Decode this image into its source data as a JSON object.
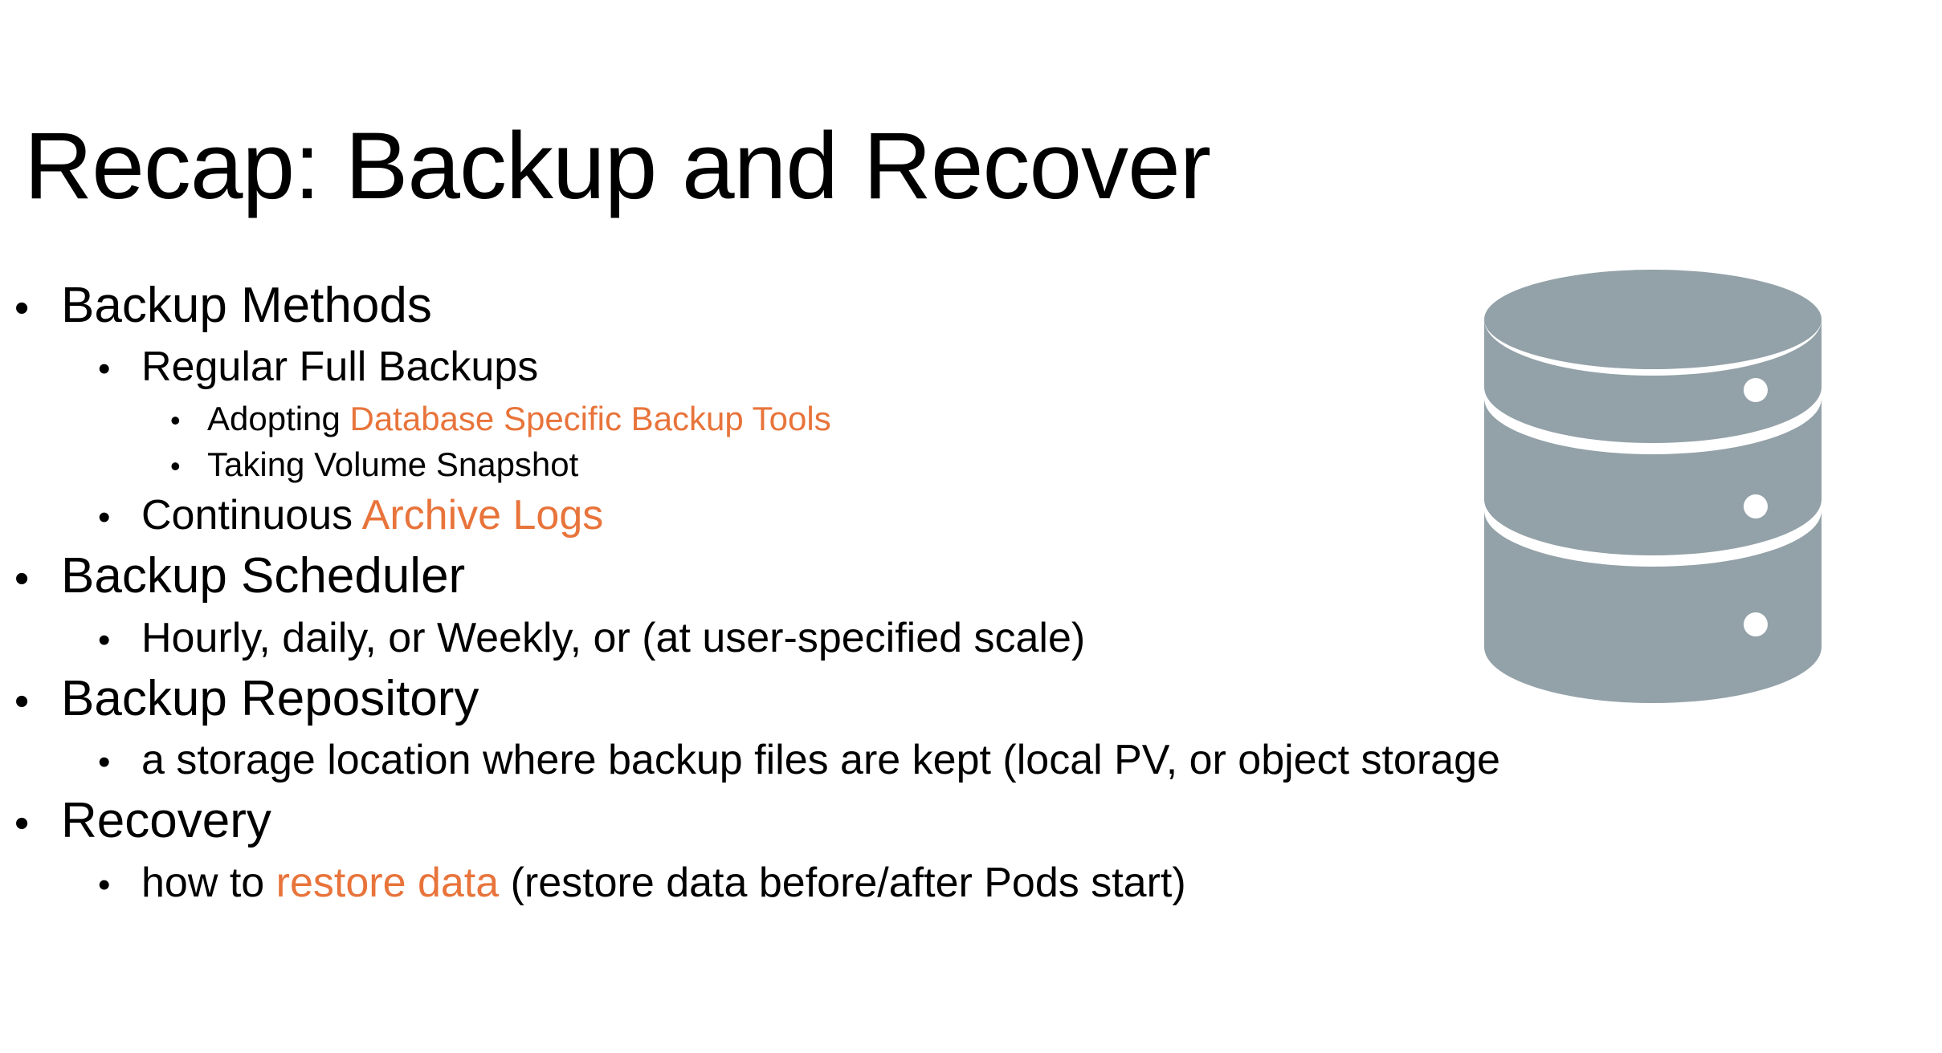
{
  "slide": {
    "title": "Recap: Backup and Recover",
    "accent_color": "#E8743B",
    "text_color": "#000000",
    "background_color": "#FFFFFF",
    "bullet_glyph": "•"
  },
  "content": {
    "items": [
      {
        "level": 1,
        "bullet": "•",
        "text": "Backup Methods",
        "pre": "Backup Methods",
        "accent": "",
        "post": ""
      },
      {
        "level": 2,
        "bullet": "•",
        "text": "Regular Full Backups",
        "pre": "Regular Full Backups",
        "accent": "",
        "post": ""
      },
      {
        "level": 3,
        "bullet": "•",
        "text": "Adopting Database Specific Backup Tools",
        "pre": "Adopting ",
        "accent": "Database Specific Backup Tools",
        "post": ""
      },
      {
        "level": 3,
        "bullet": "•",
        "text": "Taking Volume Snapshot",
        "pre": "Taking Volume Snapshot",
        "accent": "",
        "post": ""
      },
      {
        "level": 2,
        "bullet": "•",
        "text": "Continuous Archive Logs",
        "pre": "Continuous ",
        "accent": "Archive Logs",
        "post": ""
      },
      {
        "level": 1,
        "bullet": "•",
        "text": "Backup Scheduler",
        "pre": "Backup Scheduler",
        "accent": "",
        "post": ""
      },
      {
        "level": 2,
        "bullet": "•",
        "text": "Hourly, daily, or Weekly, or (at user-specified scale)",
        "pre": "Hourly, daily, or Weekly, or (at user-specified scale)",
        "accent": "",
        "post": ""
      },
      {
        "level": 1,
        "bullet": "•",
        "text": "Backup Repository",
        "pre": "Backup Repository",
        "accent": "",
        "post": ""
      },
      {
        "level": 2,
        "bullet": "•",
        "text": "a storage location where backup files are kept (local PV, or object storage",
        "pre": "a storage location where backup files are kept (local PV, or object storage",
        "accent": "",
        "post": ""
      },
      {
        "level": 1,
        "bullet": "•",
        "text": "Recovery",
        "pre": "Recovery",
        "accent": "",
        "post": ""
      },
      {
        "level": 2,
        "bullet": "•",
        "text": "how to restore data (restore data before/after Pods start)",
        "pre": "how to ",
        "accent": "restore data",
        "post": " (restore data before/after Pods start)"
      }
    ]
  },
  "graphic": {
    "name": "database-icon",
    "fill_color": "#93A1A8",
    "tiers": 3,
    "indicator_color": "#FFFFFF"
  }
}
